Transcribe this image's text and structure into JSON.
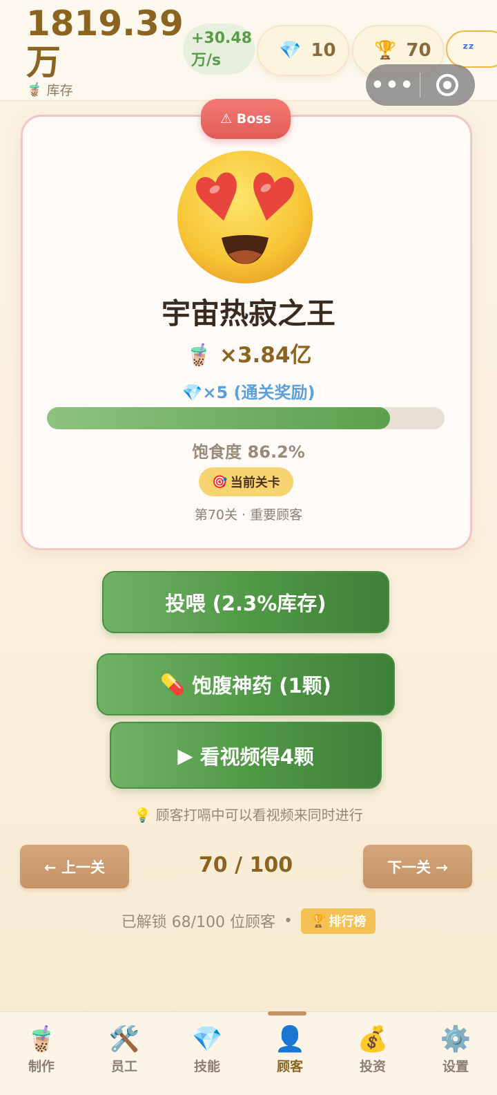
{
  "header": {
    "money_line1": "1819.39",
    "money_line2": "万",
    "stock_icon": "bubble-tea-icon",
    "stock_label": "库存",
    "rate_line1": "+30.48",
    "rate_line2": "万/s",
    "gems_icon": "gem-icon",
    "gems": "10",
    "trophy_icon": "trophy-icon",
    "trophies": "70",
    "sleep_label": "ᶻᶻ",
    "capsule_more": "•••"
  },
  "customer": {
    "badge_label": "⚠ Boss",
    "face_icon": "heart-eyes-face-icon",
    "name": "宇宙热寂之王",
    "reward_multiplier": "×3.84亿",
    "gem_reward_icon": "💎",
    "gem_reward": "×5 (通关奖励)",
    "satiety_percent": 86.2,
    "satiety_label": "饱食度 86.2%",
    "current_level_icon": "🎯",
    "current_level_label": "当前关卡",
    "level_subtitle": "第70关 · 重要顾客"
  },
  "actions": {
    "feed_label": "投喂 (2.3%库存)",
    "potion_icon": "💊",
    "potion_label": "饱腹神药 (1颗)",
    "video_icon": "▶",
    "video_label": "看视频得4颗",
    "tip_icon": "💡",
    "tip": "顾客打嗝中可以看视频来同时进行"
  },
  "navigation": {
    "prev_label": "← 上一关",
    "next_label": "下一关 →",
    "level_count": "70 / 100",
    "unlocked_text": "已解锁 68/100 位顾客",
    "separator": "•",
    "rank_icon": "🏆",
    "rank_label": "排行榜"
  },
  "tabs": [
    {
      "icon": "🧋",
      "label": "制作",
      "active": false
    },
    {
      "icon": "🛠️",
      "label": "员工",
      "active": false
    },
    {
      "icon": "💎",
      "label": "技能",
      "active": false
    },
    {
      "icon": "👤",
      "label": "顾客",
      "active": true
    },
    {
      "icon": "💰",
      "label": "投资",
      "active": false
    },
    {
      "icon": "⚙️",
      "label": "设置",
      "active": false
    }
  ],
  "colors": {
    "accent_gold": "#8a6420",
    "boss_red": "#e25c58",
    "button_green": "#4f9745",
    "nav_brown": "#c49265",
    "gem_blue": "#5ba0de"
  }
}
